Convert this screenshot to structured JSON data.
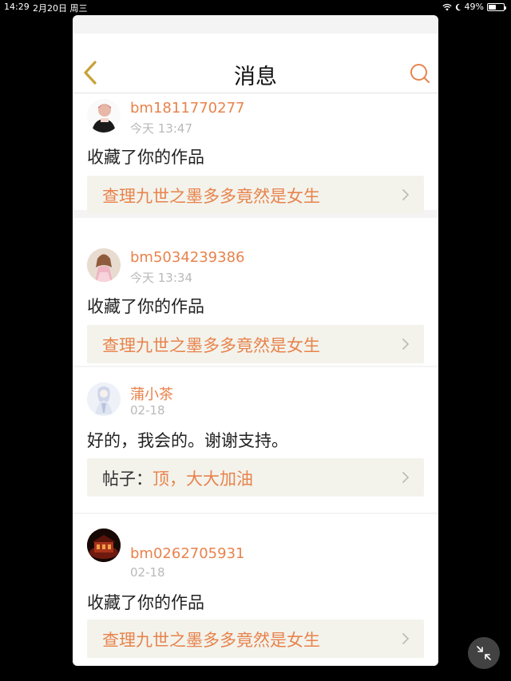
{
  "status_bar": {
    "time": "14:29",
    "date": "2月20日 周三",
    "battery": "49%",
    "battery_level": 0.49
  },
  "header": {
    "title": "消息",
    "back_icon": "chevron-left-icon",
    "search_icon": "search-icon"
  },
  "messages": [
    {
      "username": "bm1811770277",
      "time": "今天 13:47",
      "text": "收藏了你的作品",
      "ref_prefix": "",
      "ref_title": "查理九世之墨多多竟然是女生"
    },
    {
      "username": "bm5034239386",
      "time": "今天 13:34",
      "text": "收藏了你的作品",
      "ref_prefix": "",
      "ref_title": "查理九世之墨多多竟然是女生"
    },
    {
      "username": "蒲小茶",
      "time": "02-18",
      "text": "好的，我会的。谢谢支持。",
      "ref_prefix": "帖子：",
      "ref_title": "顶，大大加油"
    },
    {
      "username": "bm0262705931",
      "time": "02-18",
      "text": "收藏了你的作品",
      "ref_prefix": "",
      "ref_title": "查理九世之墨多多竟然是女生"
    }
  ],
  "colors": {
    "accent": "#e8834c",
    "background": "#f4f4f4",
    "ref_background": "#f3f3ec"
  }
}
